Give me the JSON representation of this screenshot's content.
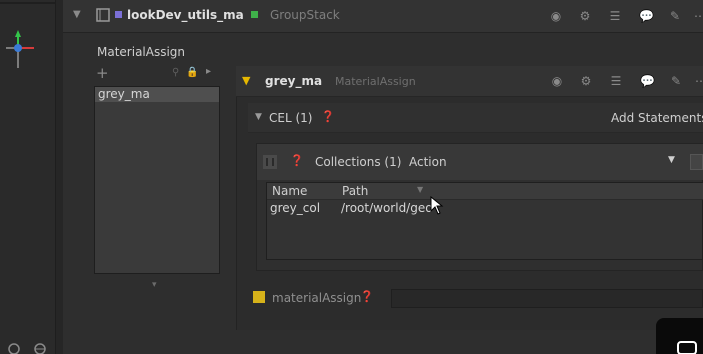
{
  "group_stack": {
    "node_name": "lookDev_utils_ma",
    "node_type": "GroupStack"
  },
  "material_assign": {
    "panel_label": "MaterialAssign",
    "node_list": [
      {
        "label": "grey_ma"
      }
    ],
    "selected_node": {
      "name": "grey_ma",
      "type": "MaterialAssign"
    },
    "cel": {
      "label": "CEL (1)",
      "add_statements": "Add Statements"
    },
    "collections": {
      "label": "Collections (1)",
      "action_label": "Action"
    },
    "table": {
      "columns": [
        "Name",
        "Path"
      ],
      "rows": [
        {
          "name": "grey_col",
          "path": "/root/world/geo"
        }
      ]
    },
    "parameter": {
      "label": "materialAssign",
      "value": ""
    }
  },
  "colors": {
    "panel_bg": "#2e2e2e",
    "group_swatch": "#7b6fd6",
    "group_badge": "#3fb04a",
    "param_badge": "#d6b21a",
    "axis_y": "#34c44a",
    "axis_x": "#d63b3b",
    "axis_z": "#3b7bd6"
  }
}
